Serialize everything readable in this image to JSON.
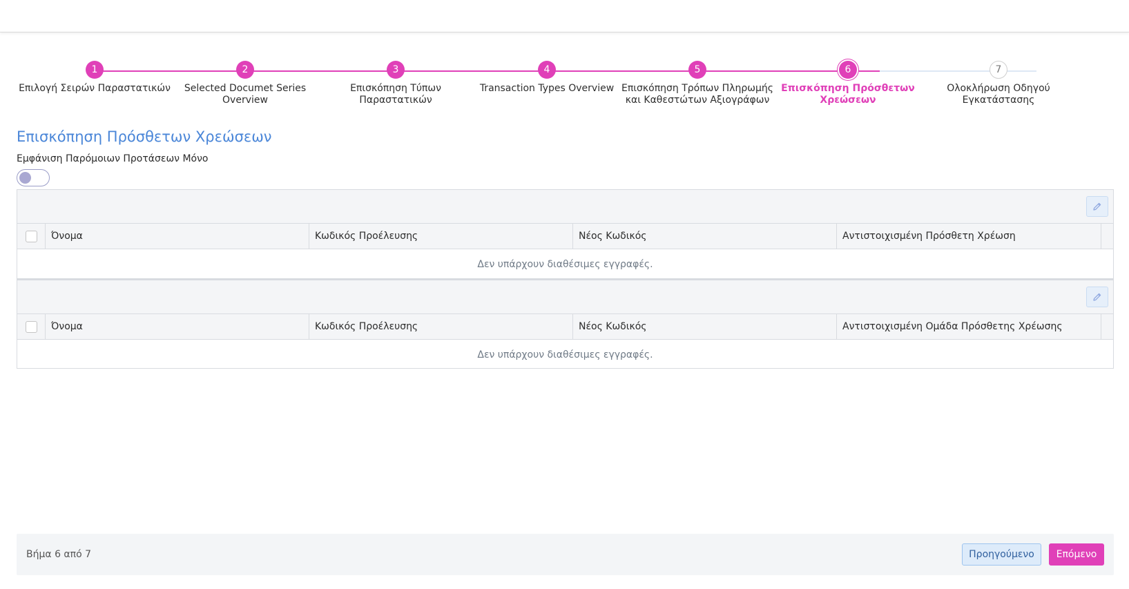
{
  "colors": {
    "accent": "#e040b8",
    "title": "#4a86d8"
  },
  "stepper": {
    "steps": [
      {
        "number": "1",
        "label": "Επιλογή Σειρών Παραστατικών",
        "state": "done"
      },
      {
        "number": "2",
        "label": "Selected Documet Series Overview",
        "state": "done"
      },
      {
        "number": "3",
        "label": "Επισκόπηση Τύπων Παραστατικών",
        "state": "done"
      },
      {
        "number": "4",
        "label": "Transaction Types Overview",
        "state": "done"
      },
      {
        "number": "5",
        "label": "Επισκόπηση Τρόπων Πληρωμής και Καθεστώτων Αξιογράφων",
        "state": "done"
      },
      {
        "number": "6",
        "label": "Επισκόπηση Πρόσθετων Χρεώσεων",
        "state": "active"
      },
      {
        "number": "7",
        "label": "Ολοκλήρωση Οδηγού Εγκατάστασης",
        "state": "todo"
      }
    ]
  },
  "page": {
    "title": "Επισκόπηση Πρόσθετων Χρεώσεων",
    "toggle_label": "Εμφάνιση Παρόμοιων Προτάσεων Μόνο"
  },
  "grid1": {
    "columns": [
      "Όνομα",
      "Κωδικός Προέλευσης",
      "Νέος Κωδικός",
      "Αντιστοιχισμένη Πρόσθετη Χρέωση"
    ],
    "empty_text": "Δεν υπάρχουν διαθέσιμες εγγραφές."
  },
  "grid2": {
    "columns": [
      "Όνομα",
      "Κωδικός Προέλευσης",
      "Νέος Κωδικός",
      "Αντιστοιχισμένη Ομάδα Πρόσθετης Χρέωσης"
    ],
    "empty_text": "Δεν υπάρχουν διαθέσιμες εγγραφές."
  },
  "footer": {
    "step_text": "Βήμα 6 από 7",
    "prev_label": "Προηγούμενο",
    "next_label": "Επόμενο"
  }
}
